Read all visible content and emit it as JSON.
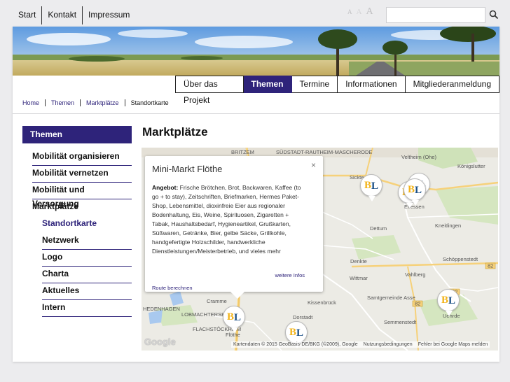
{
  "topnav": [
    "Start",
    "Kontakt",
    "Impressum"
  ],
  "fontsize": [
    "A",
    "A",
    "A"
  ],
  "search": {
    "placeholder": "",
    "icon": "search-icon"
  },
  "mainnav": [
    {
      "label": "Über das Projekt",
      "active": false
    },
    {
      "label": "Themen",
      "active": true
    },
    {
      "label": "Termine",
      "active": false
    },
    {
      "label": "Informationen",
      "active": false
    },
    {
      "label": "Mitgliederanmeldung",
      "active": false
    }
  ],
  "breadcrumb": [
    "Home",
    "Themen",
    "Marktplätze",
    "Standortkarte"
  ],
  "sidebar": {
    "title": "Themen",
    "items": [
      {
        "label": "Mobilität organisieren",
        "level": 1
      },
      {
        "label": "Mobilität vernetzen",
        "level": 1
      },
      {
        "label": "Mobilität und Versorgung",
        "level": 1
      },
      {
        "label": "Marktplätze",
        "level": 1
      },
      {
        "label": "Standortkarte",
        "level": 2,
        "active": true
      },
      {
        "label": "Netzwerk",
        "level": 2
      },
      {
        "label": "Logo",
        "level": 2
      },
      {
        "label": "Charta",
        "level": 2
      },
      {
        "label": "Aktuelles",
        "level": 2
      },
      {
        "label": "Intern",
        "level": 2
      }
    ]
  },
  "content": {
    "title": "Marktplätze"
  },
  "popup": {
    "title": "Mini-Markt Flöthe",
    "close": "×",
    "body_label": "Angebot:",
    "body_text": "Frische Brötchen, Brot, Backwaren, Kaffee (to go + to stay), Zeitschriften, Briefmarken, Hermes Paket-Shop, Lebensmittel, dioxinfreie Eier aus regionaler Bodenhaltung, Eis, Weine, Spirituosen, Zigaretten + Tabak, Haushaltsbedarf, Hygieneartikel, Grußkarten, Süßwaren, Getränke, Bier, gelbe Säcke, Grillkohle, handgefertigte Holzschilder, handwerkliche Dienstleistungen/Meisterbetrieb, und vieles mehr",
    "more": "weitere Infos",
    "route": "Route berechnen"
  },
  "map": {
    "places": [
      "BRITZEM",
      "SÜDSTADT-RAUTHEIM-MASCHERODE",
      "Veltheim (Ohe)",
      "Königslutter",
      "Sickte",
      "Evessen",
      "Dettum",
      "Kneitlingen",
      "Schöppenstedt",
      "Denkte",
      "Vahlberg",
      "Wittmar",
      "Kissenbrück",
      "Samtgemeinde Asse",
      "Semmenstedt",
      "Uehrde",
      "Cramme",
      "Dorstadt",
      "Flöthe",
      "HEDENHAGEN",
      "LOBMACHTERSEN",
      "FLACHSTÖCKHEIM"
    ],
    "roads": [
      "82",
      "82",
      "82"
    ],
    "google": "Google",
    "footer": [
      "Kartendaten © 2015 GeoBasis-DE/BKG (©2009), Google",
      "Nutzungsbedingungen",
      "Fehler bei Google Maps melden"
    ]
  },
  "colors": {
    "accent": "#2e237a",
    "marker_b": "#f2b319",
    "marker_l": "#1a4f86"
  }
}
